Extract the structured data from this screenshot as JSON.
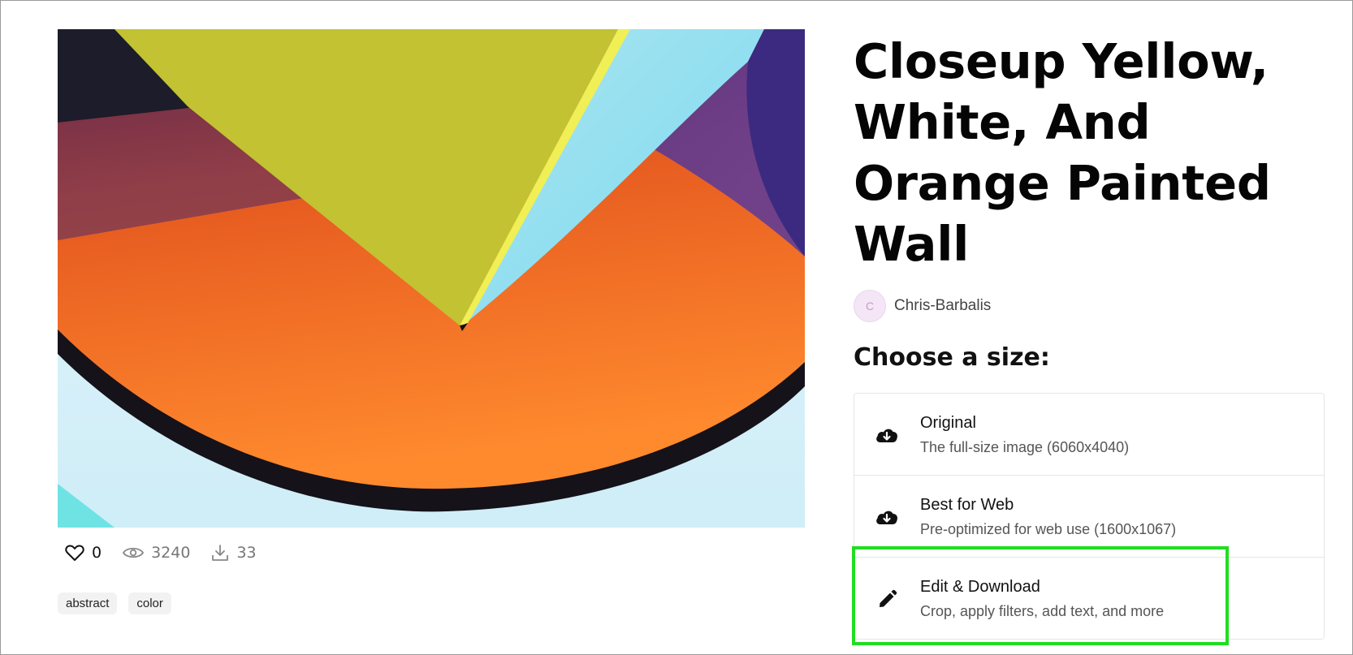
{
  "photo": {
    "alt": "Closeup yellow, white, and orange painted wall"
  },
  "stats": {
    "likes": "0",
    "views": "3240",
    "downloads": "33"
  },
  "tags": [
    "abstract",
    "color"
  ],
  "title": "Closeup Yellow, White, And Orange Painted Wall",
  "author": {
    "initial": "C",
    "name": "Chris-Barbalis"
  },
  "size_heading": "Choose a size:",
  "options": [
    {
      "icon": "cloud-download-icon",
      "title": "Original",
      "desc": "The full-size image (6060x4040)"
    },
    {
      "icon": "cloud-download-icon",
      "title": "Best for Web",
      "desc": "Pre-optimized for web use (1600x1067)"
    },
    {
      "icon": "pencil-icon",
      "title": "Edit & Download",
      "desc": "Crop, apply filters, add text, and more"
    }
  ],
  "colors": {
    "highlight": "#22dd22",
    "avatar_bg": "#f4e6f6"
  }
}
